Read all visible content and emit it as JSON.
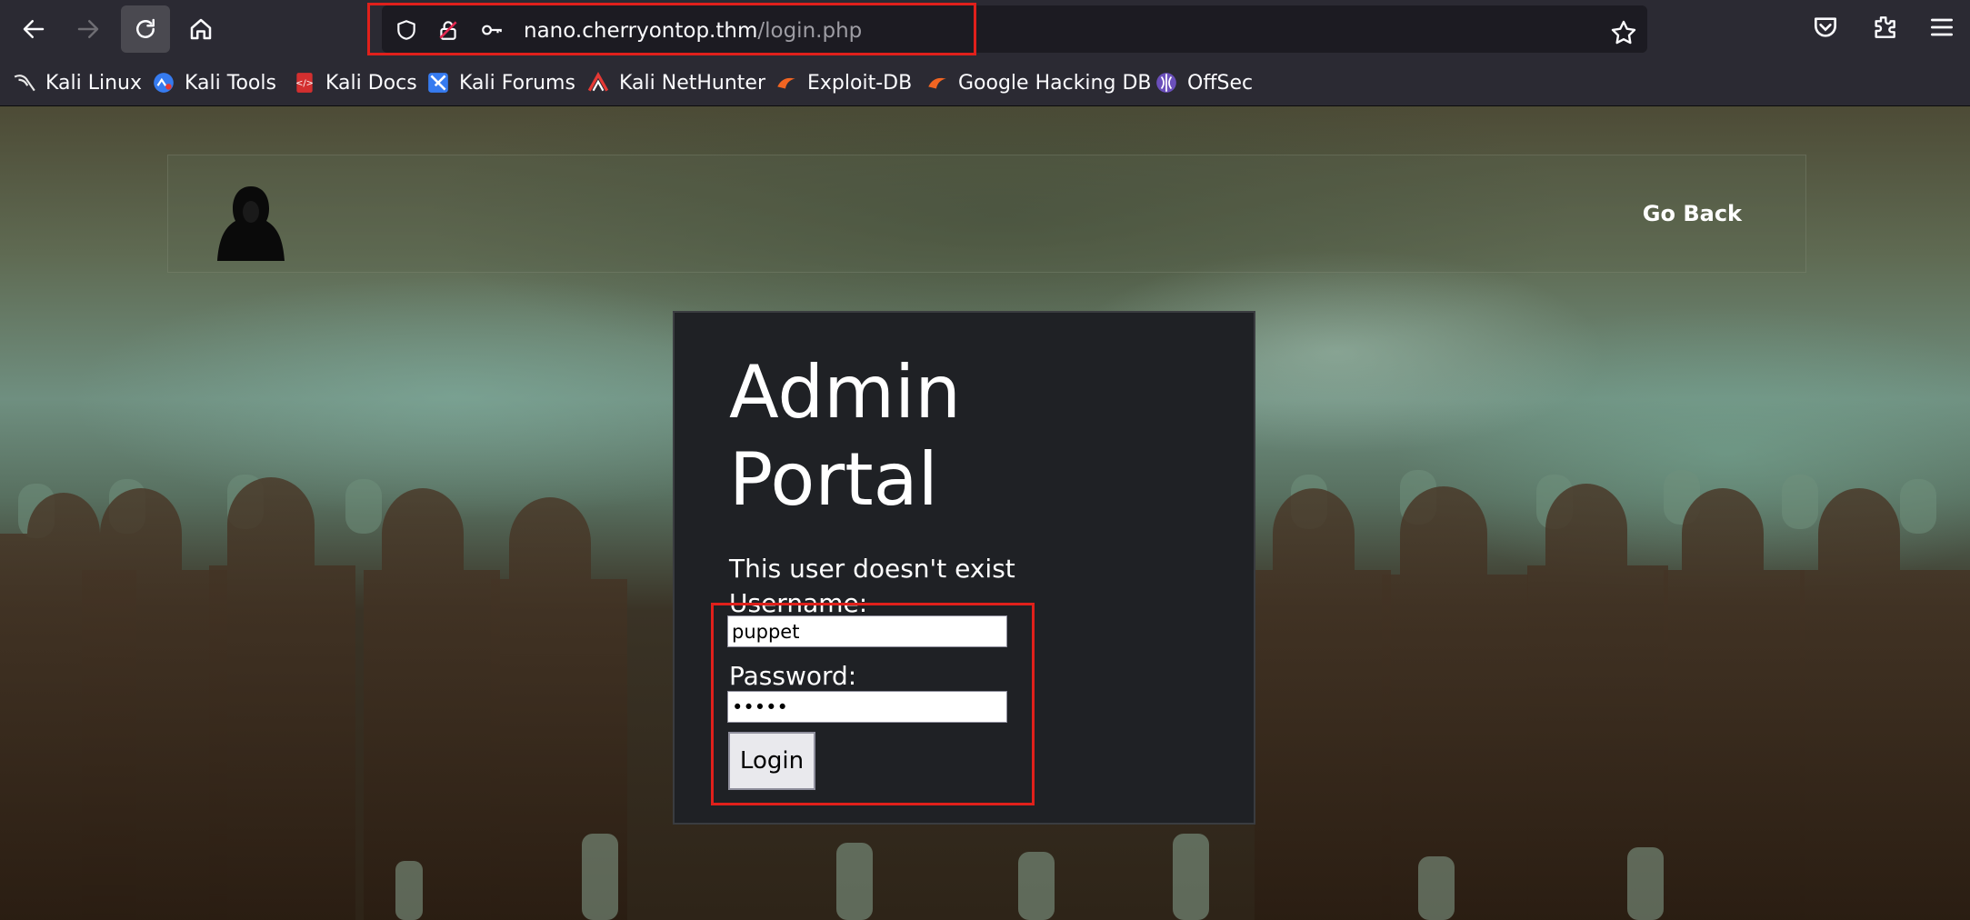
{
  "browser": {
    "url_host": "nano.cherryontop.thm",
    "url_path": "/login.php",
    "highlight_color": "#e0201b"
  },
  "bookmarks": [
    {
      "label": "Kali Linux",
      "icon": "kali-dragon-icon"
    },
    {
      "label": "Kali Tools",
      "icon": "kali-tools-icon"
    },
    {
      "label": "Kali Docs",
      "icon": "kali-docs-icon"
    },
    {
      "label": "Kali Forums",
      "icon": "kali-forums-icon"
    },
    {
      "label": "Kali NetHunter",
      "icon": "nethunter-icon"
    },
    {
      "label": "Exploit-DB",
      "icon": "exploit-db-icon"
    },
    {
      "label": "Google Hacking DB",
      "icon": "ghdb-icon"
    },
    {
      "label": "OffSec",
      "icon": "offsec-icon"
    }
  ],
  "site": {
    "nav_link": "Go Back"
  },
  "login": {
    "title_line1": "Admin",
    "title_line2": "Portal",
    "message": "This user doesn't exist",
    "username_label": "Username:",
    "username_value": "puppet",
    "password_label": "Password:",
    "password_mask": "•••••",
    "button_label": "Login"
  }
}
